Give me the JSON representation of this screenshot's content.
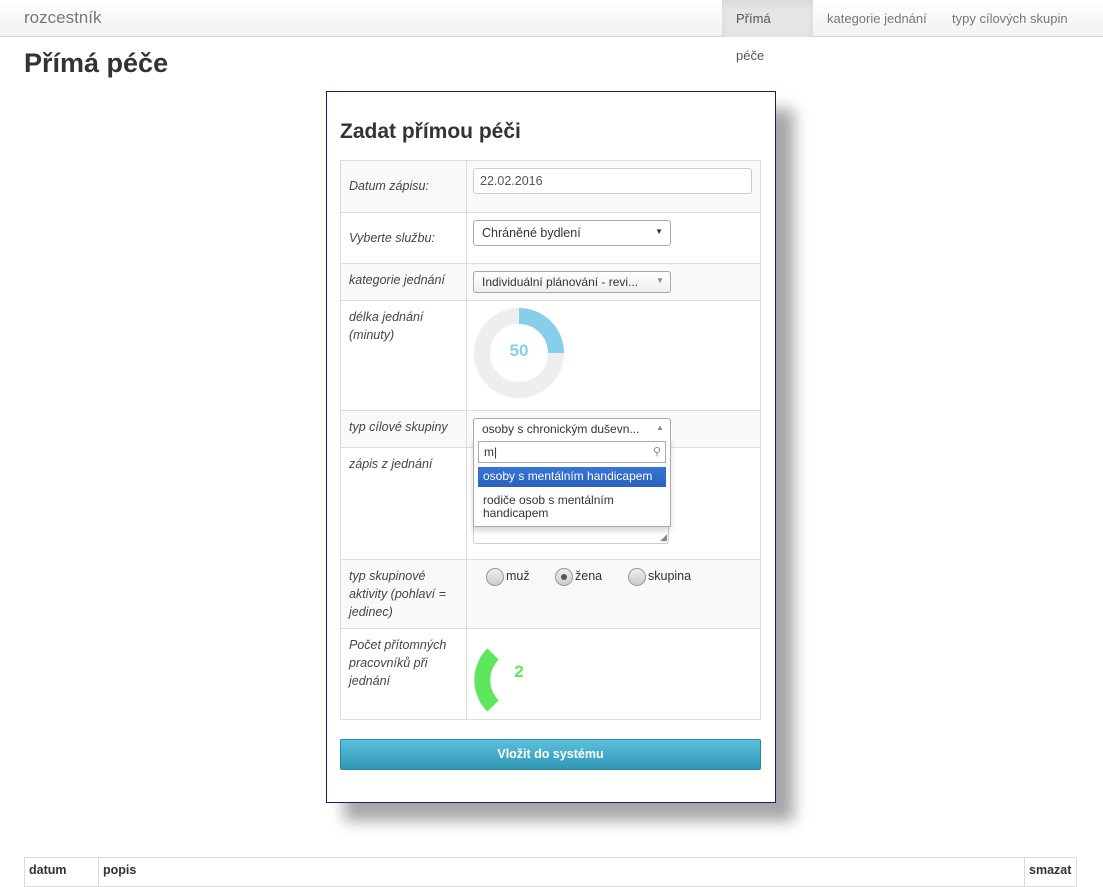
{
  "nav": {
    "brand": "rozcestník",
    "items": [
      {
        "label": "Přímá péče",
        "active": true
      },
      {
        "label": "kategorie jednání",
        "active": false
      },
      {
        "label": "typy cílových skupin",
        "active": false
      }
    ]
  },
  "page": {
    "title": "Přímá péče"
  },
  "form": {
    "title": "Zadat přímou péči",
    "date": {
      "label": "Datum zápisu:",
      "value": "22.02.2016"
    },
    "service": {
      "label": "Vyberte službu:",
      "value": "Chráněné bydlení"
    },
    "category": {
      "label": "kategorie jednání",
      "value": "Individuální plánování - revi..."
    },
    "duration": {
      "label": "délka jednání (minuty)",
      "value": "50",
      "max": 200,
      "color": "#87ceeb"
    },
    "target_group": {
      "label": "typ cílové skupiny",
      "value": "osoby s chronickým duševn...",
      "search": "m",
      "options": [
        "osoby s mentálním handicapem",
        "rodiče osob s mentálním handicapem"
      ]
    },
    "notes": {
      "label": "zápis z jednání"
    },
    "activity": {
      "label": "typ skupinové aktivity (pohlaví = jedinec)",
      "options": [
        {
          "label": "muž",
          "checked": false
        },
        {
          "label": "žena",
          "checked": true
        },
        {
          "label": "skupina",
          "checked": false
        }
      ]
    },
    "staff": {
      "label": "Počet přítomných pracovníků při jednání",
      "value": "2",
      "color": "#5ee65e"
    },
    "submit": "Vložit do systému"
  },
  "table": {
    "headers": [
      "datum",
      "popis",
      "smazat"
    ]
  }
}
